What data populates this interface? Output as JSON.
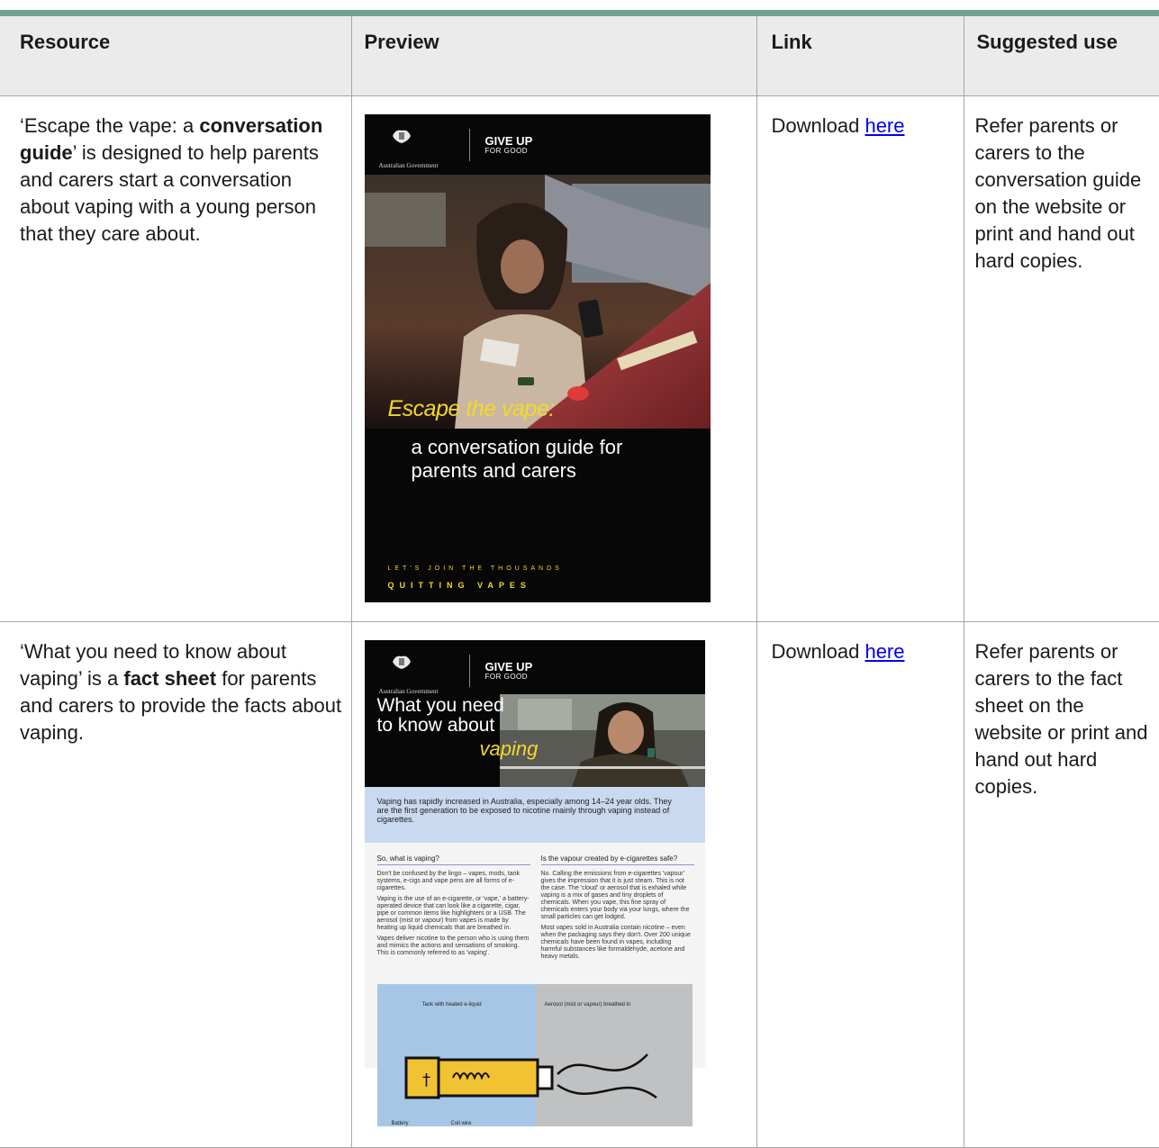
{
  "table": {
    "headers": [
      "Resource",
      "Preview",
      "Link",
      "Suggested use"
    ],
    "rows": [
      {
        "resource": {
          "pre": "‘Escape the vape: a ",
          "bold": "conversation guide",
          "post": "’ is designed to help parents and carers start a conversation about vaping with a young person that they care about."
        },
        "link_prefix": "Download ",
        "link_text": "here",
        "use": "Refer parents or carers to the conversation guide on the website or print and hand out hard copies.",
        "preview": {
          "govt": "Australian Government",
          "brand_top": "GIVE UP",
          "brand_bottom": "FOR GOOD",
          "title": "Escape the vape:",
          "subtitle_1": "a conversation guide for",
          "subtitle_2": "parents and carers",
          "tagline_1": "LET'S JOIN THE THOUSANDS",
          "tagline_2": "QUITTING VAPES"
        }
      },
      {
        "resource": {
          "pre": "‘What you need to know about vaping’ is a ",
          "bold": "fact sheet",
          "post": " for parents and carers to provide the facts about vaping."
        },
        "link_prefix": "Download ",
        "link_text": "here",
        "use": "Refer parents or carers to the fact sheet on the website or print and hand out hard copies.",
        "preview": {
          "govt": "Australian Government",
          "brand_top": "GIVE UP",
          "brand_bottom": "FOR GOOD",
          "title_1": "What you need",
          "title_2": "to know about",
          "title_3": "vaping",
          "intro": "Vaping has rapidly increased in Australia, especially among 14–24 year olds. They are the first generation to be exposed to nicotine mainly through vaping instead of cigarettes.",
          "col1_heading": "So, what is vaping?",
          "col1_p1": "Don't be confused by the lingo – vapes, mods, tank systems, e-cigs and vape pens are all forms of e-cigarettes.",
          "col1_p2": "Vaping is the use of an e-cigarette, or 'vape,' a battery-operated device that can look like a cigarette, cigar, pipe or common items like highlighters or a USB. The aerosol (mist or vapour) from vapes is made by heating up liquid chemicals that are breathed in.",
          "col1_p3": "Vapes deliver nicotine to the person who is using them and mimics the actions and sensations of smoking. This is commonly referred to as 'vaping'.",
          "col2_heading": "Is the vapour created by e-cigarettes safe?",
          "col2_p1": "No. Calling the emissions from e-cigarettes 'vapour' gives the impression that it is just steam. This is not the case. The 'cloud' or aerosol that is exhaled while vaping is a mix of gases and tiny droplets of chemicals. When you vape, this fine spray of chemicals enters your body via your lungs, where the small particles can get lodged.",
          "col2_p2": "Most vapes sold in Australia contain nicotine – even when the packaging says they don't. Over 200 unique chemicals have been found in vapes, including harmful substances like formaldehyde, acetone and heavy metals.",
          "diagram_left": "Tank with heated e-liquid",
          "diagram_right": "Aerosol (mist or vapour) breathed in",
          "diagram_battery": "Battery",
          "diagram_coil": "Coil wire"
        }
      }
    ]
  },
  "colors": {
    "accent_bar": "#6fa291",
    "header_bg": "#ebebeb",
    "link": "#0000ee",
    "cover_yellow": "#f4d82a"
  }
}
